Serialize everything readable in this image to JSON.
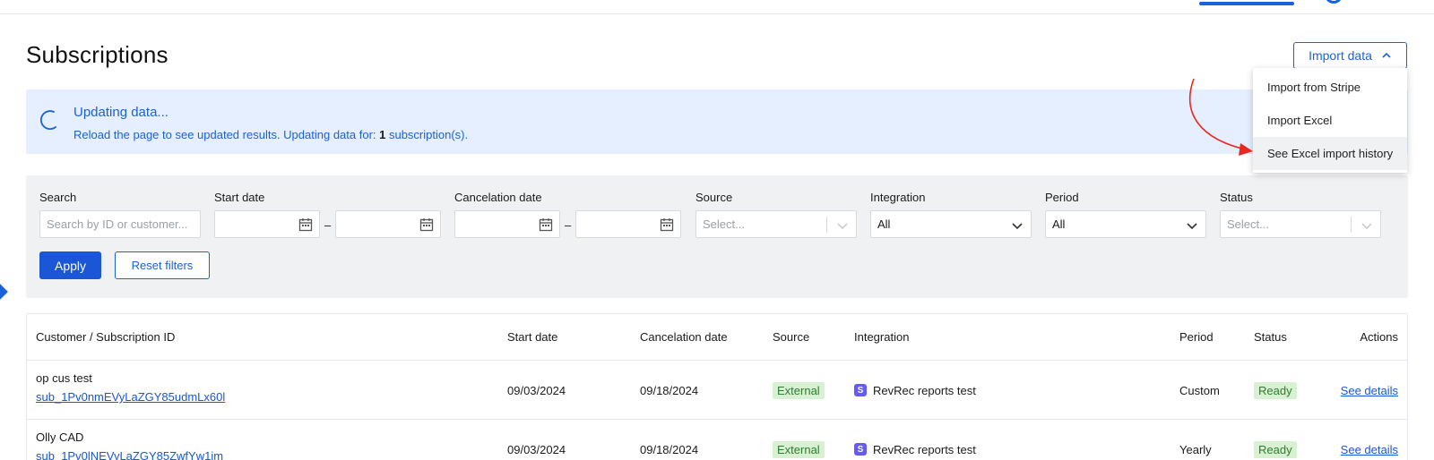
{
  "header": {
    "page_title": "Subscriptions",
    "import_button_label": "Import data"
  },
  "import_menu": {
    "items": [
      "Import from Stripe",
      "Import Excel",
      "See Excel import history"
    ]
  },
  "banner": {
    "title": "Updating data...",
    "text_prefix": "Reload the page to see updated results. Updating data for: ",
    "count": "1",
    "text_suffix": " subscription(s)."
  },
  "filters": {
    "search_label": "Search",
    "search_placeholder": "Search by ID or customer...",
    "start_date_label": "Start date",
    "cancelation_date_label": "Cancelation date",
    "source_label": "Source",
    "source_placeholder": "Select...",
    "integration_label": "Integration",
    "integration_value": "All",
    "period_label": "Period",
    "period_value": "All",
    "status_label": "Status",
    "status_placeholder": "Select...",
    "range_separator": "–",
    "apply_label": "Apply",
    "reset_label": "Reset filters"
  },
  "table": {
    "columns": [
      "Customer / Subscription ID",
      "Start date",
      "Cancelation date",
      "Source",
      "Integration",
      "Period",
      "Status",
      "Actions"
    ],
    "rows": [
      {
        "customer": "op cus test",
        "subscription_id": "sub_1Pv0nmEVyLaZGY85udmLx60l",
        "start_date": "09/03/2024",
        "cancelation_date": "09/18/2024",
        "source": "External",
        "integration": "RevRec reports test",
        "period": "Custom",
        "status": "Ready",
        "action": "See details"
      },
      {
        "customer": "Olly CAD",
        "subscription_id": "sub_1Pv0lNEVyLaZGY85ZwfYw1im",
        "start_date": "09/03/2024",
        "cancelation_date": "09/18/2024",
        "source": "External",
        "integration": "RevRec reports test",
        "period": "Yearly",
        "status": "Ready",
        "action": "See details"
      }
    ]
  },
  "colors": {
    "accent": "#1a62d9",
    "banner_bg": "#e5efff",
    "badge_green_bg": "#d8f1d2",
    "annotation_arrow": "#e8281e"
  }
}
